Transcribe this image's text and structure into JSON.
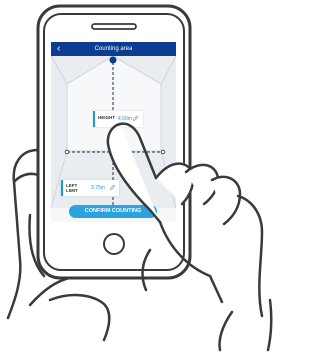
{
  "app": {
    "title": "Counting area",
    "back_icon": "chevron-left-icon"
  },
  "fields": {
    "height": {
      "label": "HEIGHT",
      "value": "4.50m",
      "icon": "pencil-icon"
    },
    "left_limit": {
      "label": "LEFT\nLIMIT",
      "value": "3.75m",
      "icon": "pencil-icon"
    }
  },
  "actions": {
    "confirm_label": "CONFIRM COUNTING"
  },
  "colors": {
    "header": "#0b3d91",
    "accent": "#1a9bd7",
    "button": "#2aa3e0",
    "outline": "#3a3a3a"
  }
}
